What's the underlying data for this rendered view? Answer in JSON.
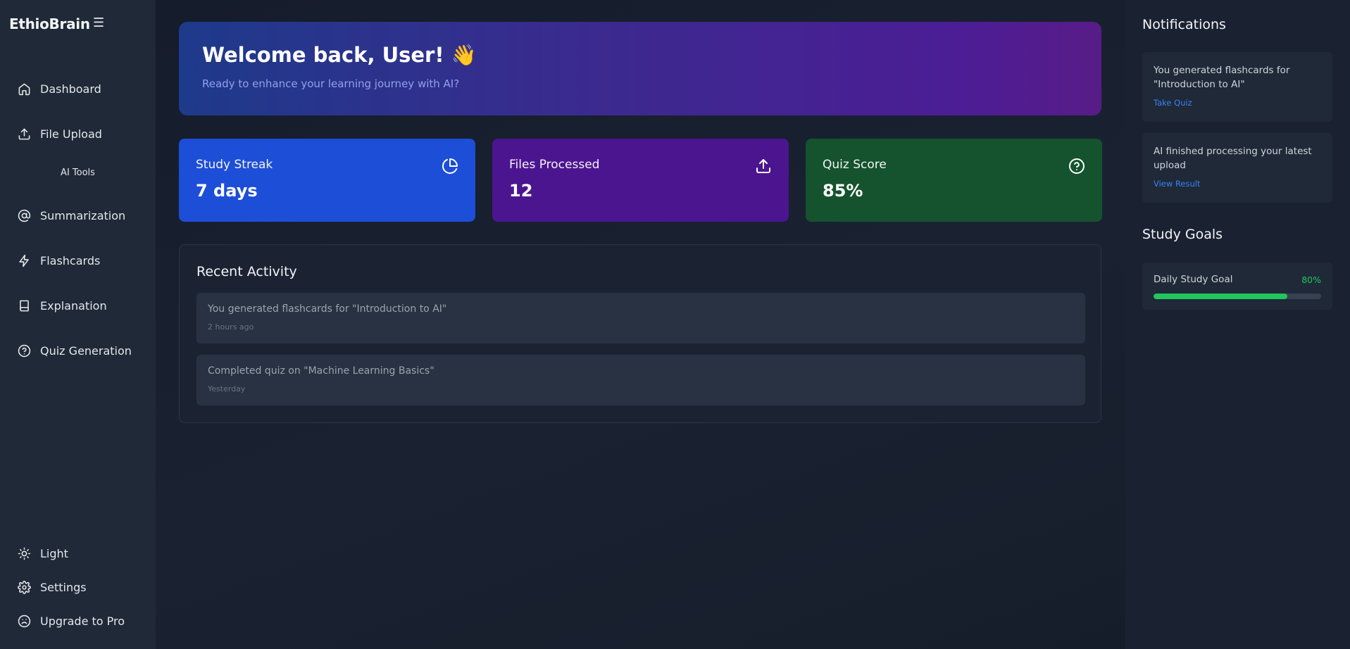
{
  "sidebar": {
    "brand": "EthioBrain",
    "toggle_icon": "☰",
    "items": [
      {
        "label": "Dashboard",
        "icon": "home-icon"
      },
      {
        "label": "File Upload",
        "icon": "upload-icon"
      },
      {
        "label": "Summarization",
        "icon": "at-icon"
      },
      {
        "label": "Flashcards",
        "icon": "lightning-icon"
      },
      {
        "label": "Explanation",
        "icon": "book-icon"
      },
      {
        "label": "Quiz Generation",
        "icon": "help-circle-icon"
      }
    ],
    "section_label": "AI Tools",
    "bottom_items": [
      {
        "label": "Light",
        "icon": "sun-icon"
      },
      {
        "label": "Settings",
        "icon": "gear-icon"
      },
      {
        "label": "Upgrade to Pro",
        "icon": "frown-icon"
      }
    ]
  },
  "hero": {
    "title": "Welcome back, User! 👋",
    "subtitle": "Ready to enhance your learning journey with AI?"
  },
  "stats": [
    {
      "label": "Study Streak",
      "value": "7 days",
      "icon": "pie-chart-icon",
      "color": "#1d4ed8"
    },
    {
      "label": "Files Processed",
      "value": "12",
      "icon": "upload-icon",
      "color": "#4c1590"
    },
    {
      "label": "Quiz Score",
      "value": "85%",
      "icon": "help-circle-icon",
      "color": "#14532d"
    }
  ],
  "activity": {
    "title": "Recent Activity",
    "items": [
      {
        "text": "You generated flashcards for \"Introduction to AI\"",
        "time": "2 hours ago"
      },
      {
        "text": "Completed quiz on \"Machine Learning Basics\"",
        "time": "Yesterday"
      }
    ]
  },
  "notifications": {
    "title": "Notifications",
    "items": [
      {
        "text": "You generated flashcards for \"Introduction to AI\"",
        "link": "Take Quiz"
      },
      {
        "text": "AI finished processing your latest upload",
        "link": "View Result"
      }
    ]
  },
  "goals": {
    "title": "Study Goals",
    "items": [
      {
        "label": "Daily Study Goal",
        "percent_label": "80%",
        "progress": 0.8,
        "color": "#22c55e"
      }
    ]
  }
}
